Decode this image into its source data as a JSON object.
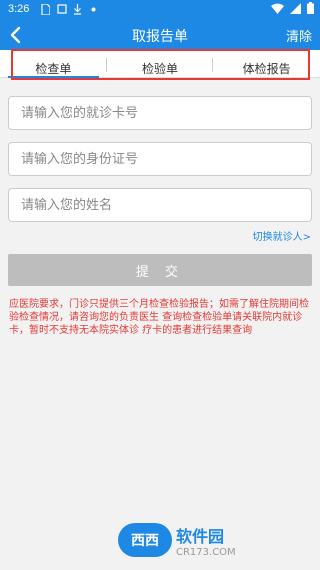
{
  "status_bar": {
    "time": "3:26",
    "icons": [
      "sim-card-icon",
      "notification-icon",
      "download-icon",
      "dot-icon"
    ],
    "right_icons": [
      "wifi-icon",
      "signal-icon",
      "battery-icon"
    ]
  },
  "header": {
    "title": "取报告单",
    "clear_label": "清除"
  },
  "tabs": [
    {
      "label": "检查单",
      "active": true
    },
    {
      "label": "检验单",
      "active": false
    },
    {
      "label": "体检报告",
      "active": false
    }
  ],
  "form": {
    "card_placeholder": "请输入您的就诊卡号",
    "id_placeholder": "请输入您的身份证号",
    "name_placeholder": "请输入您的姓名",
    "switch_link": "切换就诊人>",
    "submit_label": "提 交"
  },
  "notice": "应医院要求，门诊只提供三个月检查检验报告；如需了解住院期间检验检查情况，请咨询您的负责医生 查询检查检验单请关联院内就诊卡，暂时不支持无本院实体诊 疗卡的患者进行结果查询",
  "watermark": {
    "logo_text": "西西",
    "name": "软件园",
    "url": "CR173.COM"
  },
  "colors": {
    "primary": "#1e88e5",
    "notice": "#e53935",
    "button_disabled": "#bdbdbd"
  }
}
